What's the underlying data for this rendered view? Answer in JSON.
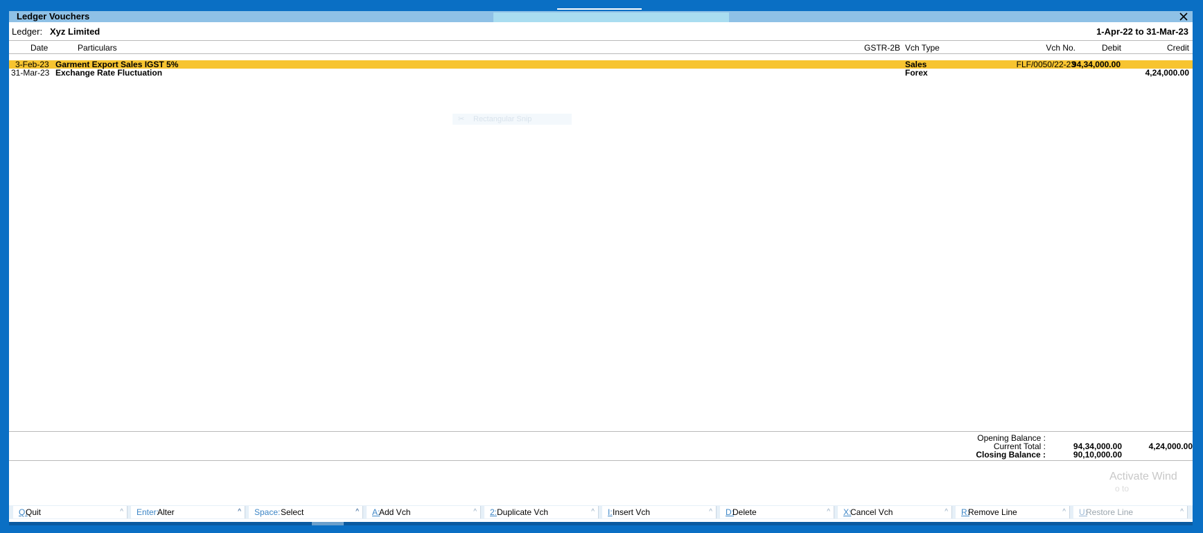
{
  "window": {
    "title": "Ledger Vouchers"
  },
  "ledger": {
    "label": "Ledger:",
    "name": "Xyz Limited",
    "period": "1-Apr-22 to 31-Mar-23"
  },
  "columns": {
    "date": "Date",
    "particulars": "Particulars",
    "gstr2b": "GSTR-2B",
    "vch_type": "Vch Type",
    "vch_no": "Vch No.",
    "debit": "Debit",
    "credit": "Credit"
  },
  "rows": [
    {
      "date": "3-Feb-23",
      "particulars": "Garment Export Sales IGST 5%",
      "gstr2b": "",
      "vch_type": "Sales",
      "vch_no": "FLF/0050/22-23",
      "debit": "94,34,000.00",
      "credit": "",
      "selected": true
    },
    {
      "date": "31-Mar-23",
      "particulars": "Exchange Rate Fluctuation",
      "gstr2b": "",
      "vch_type": "Forex",
      "vch_no": "",
      "debit": "",
      "credit": "4,24,000.00",
      "selected": false
    }
  ],
  "snip_overlay": {
    "icon": "scissors-icon",
    "text": "Rectangular Snip"
  },
  "totals": {
    "opening_label": "Opening Balance :",
    "opening_debit": "",
    "opening_credit": "",
    "current_label": "Current Total :",
    "current_debit": "94,34,000.00",
    "current_credit": "4,24,000.00",
    "closing_label": "Closing Balance :",
    "closing_debit": "90,10,000.00",
    "closing_credit": ""
  },
  "watermark": {
    "line1": "Activate Wind",
    "line2": "o to"
  },
  "buttons": [
    {
      "key": "Q",
      "label": "Quit"
    },
    {
      "key": "Enter",
      "label": "Alter"
    },
    {
      "key": "Space",
      "label": "Select"
    },
    {
      "key": "A",
      "label": "Add Vch"
    },
    {
      "key": "2",
      "label": "Duplicate Vch"
    },
    {
      "key": "I",
      "label": "Insert Vch"
    },
    {
      "key": "D",
      "label": "Delete"
    },
    {
      "key": "X",
      "label": "Cancel Vch"
    },
    {
      "key": "R",
      "label": "Remove Line"
    },
    {
      "key": "U",
      "label": "Restore Line"
    }
  ],
  "colors": {
    "background": "#0a6fc4",
    "titlebar": "#8fc1e6",
    "selection": "#f7c430",
    "shortcut_key": "#3d86c6"
  }
}
